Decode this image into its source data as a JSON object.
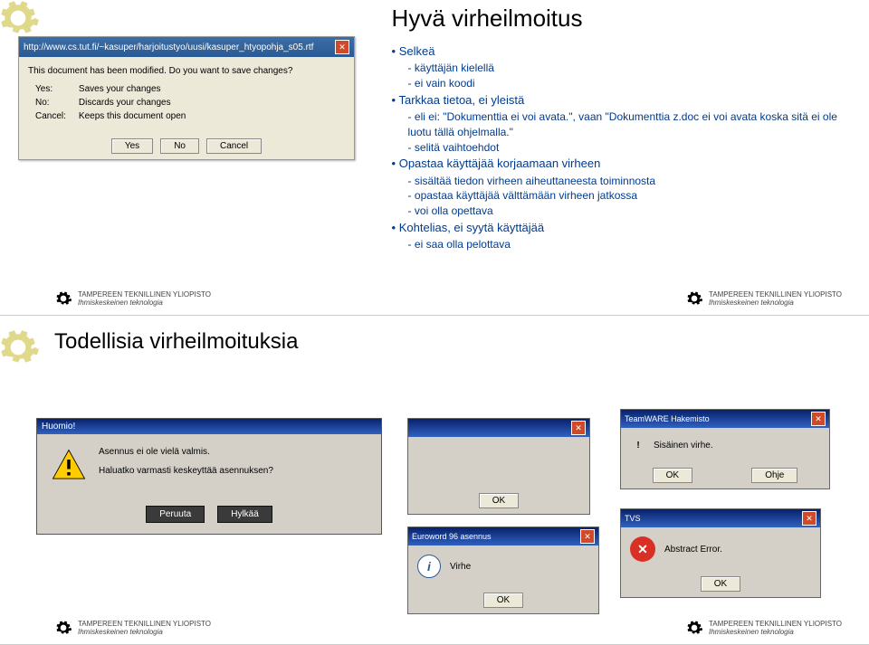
{
  "slide1": {
    "title": "Hyvä virheilmoitus",
    "bullets": {
      "b1": "Selkeä",
      "b1a": "käyttäjän kielellä",
      "b1b": "ei vain koodi",
      "b2": "Tarkkaa tietoa, ei yleistä",
      "b2a": "eli ei: \"Dokumenttia ei voi avata.\", vaan \"Dokumenttia z.doc ei voi avata koska sitä ei ole luotu tällä ohjelmalla.\"",
      "b2b": "selitä vaihtoehdot",
      "b3": "Opastaa käyttäjää korjaamaan virheen",
      "b3a": "sisältää tiedon virheen aiheuttaneesta toiminnosta",
      "b3b": "opastaa käyttäjää välttämään virheen jatkossa",
      "b3c": "voi olla opettava",
      "b4": "Kohtelias, ei syytä käyttäjää",
      "b4a": "ei saa olla pelottava"
    },
    "dialog": {
      "title": "http://www.cs.tut.fi/~kasuper/harjoitustyo/uusi/kasuper_htyopohja_s05.rtf",
      "msg": "This document has been modified. Do you want to save changes?",
      "yes_lbl": "Yes:",
      "yes_txt": "Saves your changes",
      "no_lbl": "No:",
      "no_txt": "Discards your changes",
      "cancel_lbl": "Cancel:",
      "cancel_txt": "Keeps this document open",
      "btn_yes": "Yes",
      "btn_no": "No",
      "btn_cancel": "Cancel"
    }
  },
  "slide2": {
    "title": "Todellisia virheilmoituksia",
    "huomio": {
      "title": "Huomio!",
      "line1": "Asennus ei ole vielä valmis.",
      "line2": "Haluatko varmasti keskeyttää asennuksen?",
      "btn_peruuta": "Peruuta",
      "btn_hylkaa": "Hylkää"
    },
    "empty_ok": {
      "btn": "OK"
    },
    "teamware": {
      "title": "TeamWARE Hakemisto",
      "msg": "Sisäinen virhe.",
      "btn_ok": "OK",
      "btn_ohje": "Ohje"
    },
    "euroword": {
      "title": "Euroword 96 asennus",
      "msg": "Virhe",
      "btn": "OK"
    },
    "tvs": {
      "title": "TVS",
      "msg": "Abstract Error.",
      "btn": "OK"
    }
  },
  "footer": {
    "line1": "TAMPEREEN TEKNILLINEN YLIOPISTO",
    "line2": "Ihmiskeskeinen teknologia"
  }
}
